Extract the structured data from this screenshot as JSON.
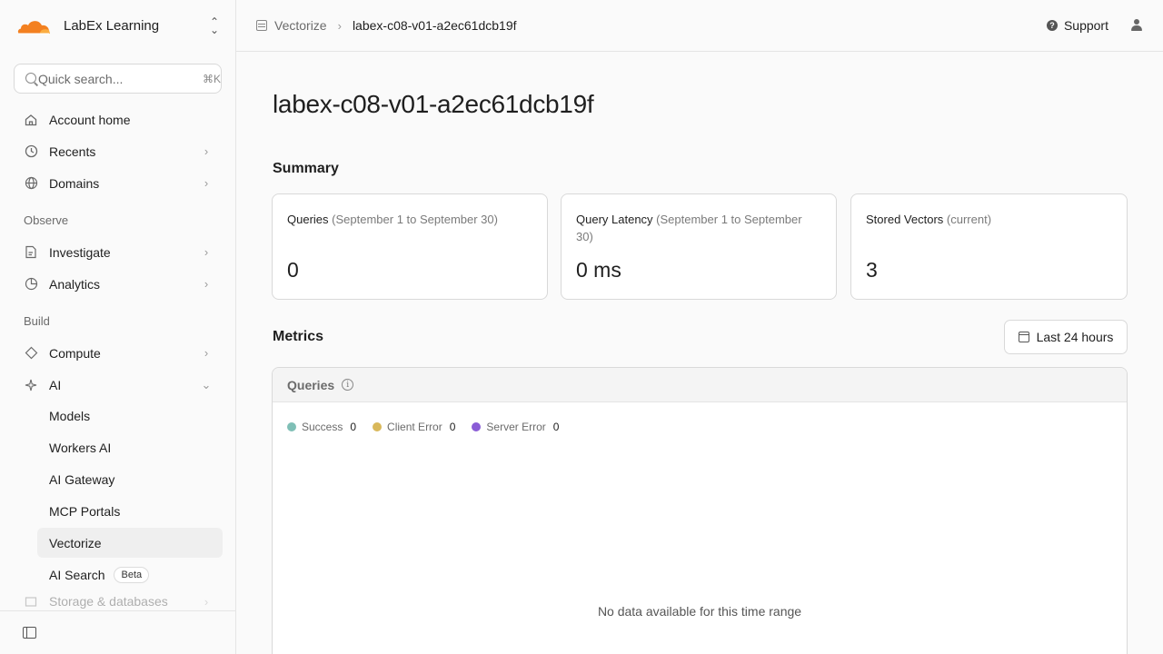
{
  "account": {
    "name": "LabEx Learning"
  },
  "search": {
    "placeholder": "Quick search...",
    "shortcut": "⌘K"
  },
  "nav": {
    "top_items": [
      {
        "label": "Account home"
      },
      {
        "label": "Recents"
      },
      {
        "label": "Domains"
      }
    ],
    "observe_title": "Observe",
    "observe_items": [
      {
        "label": "Investigate"
      },
      {
        "label": "Analytics"
      }
    ],
    "build_title": "Build",
    "build_items": [
      {
        "label": "Compute"
      },
      {
        "label": "AI"
      }
    ],
    "ai_sub_items": [
      {
        "label": "Models"
      },
      {
        "label": "Workers AI"
      },
      {
        "label": "AI Gateway"
      },
      {
        "label": "MCP Portals"
      },
      {
        "label": "Vectorize"
      },
      {
        "label": "AI Search",
        "badge": "Beta"
      }
    ],
    "faded_item": {
      "label": "Storage & databases"
    }
  },
  "breadcrumb": {
    "parent": "Vectorize",
    "current": "labex-c08-v01-a2ec61dcb19f"
  },
  "topbar": {
    "support_label": "Support"
  },
  "page": {
    "title": "labex-c08-v01-a2ec61dcb19f"
  },
  "summary": {
    "title": "Summary",
    "cards": [
      {
        "label": "Queries",
        "qualifier": "(September 1 to September 30)",
        "value": "0"
      },
      {
        "label": "Query Latency",
        "qualifier": "(September 1 to September 30)",
        "value": "0 ms"
      },
      {
        "label": "Stored Vectors",
        "qualifier": "(current)",
        "value": "3"
      }
    ]
  },
  "metrics": {
    "title": "Metrics",
    "range_label": "Last 24 hours",
    "panel_title": "Queries",
    "legend": [
      {
        "label": "Success",
        "value": "0",
        "color": "#7fbfb6"
      },
      {
        "label": "Client Error",
        "value": "0",
        "color": "#d9b85a"
      },
      {
        "label": "Server Error",
        "value": "0",
        "color": "#8a5cd6"
      }
    ],
    "empty_message": "No data available for this time range"
  },
  "colors": {
    "brand_orange": "#f38020",
    "active_bg": "#efefef"
  }
}
